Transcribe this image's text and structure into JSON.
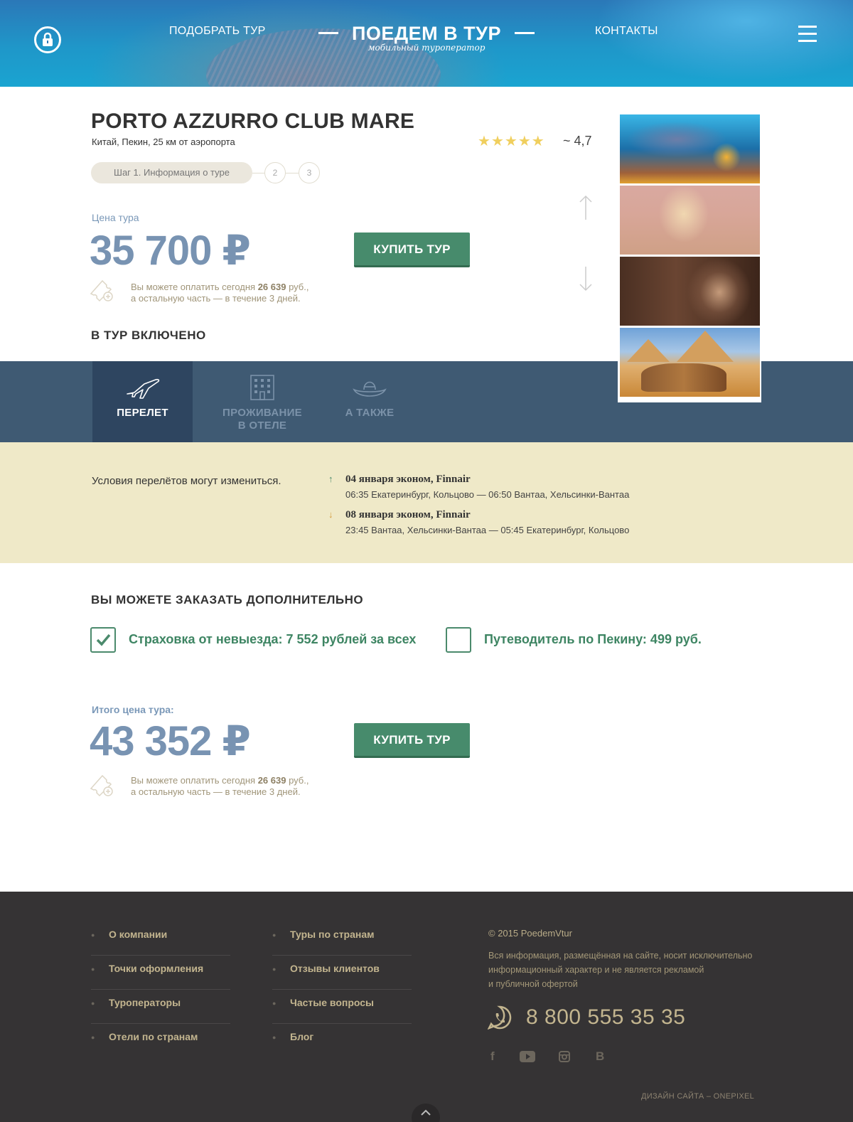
{
  "header": {
    "nav_pick": "ПОДОБРАТЬ ТУР",
    "nav_contacts": "КОНТАКТЫ",
    "logo_title": "ПОЕДЕМ В ТУР",
    "logo_subtitle": "мобильный туроператор",
    "icons": {
      "lock": "lock-icon",
      "menu": "menu-icon"
    }
  },
  "hotel": {
    "name": "PORTO AZZURRO CLUB MARE",
    "location": "Китай, Пекин, 25 км от аэропорта",
    "rating_stars": 5,
    "rating_value": "~ 4,7"
  },
  "steps": {
    "step1": "Шаг 1. Информация о туре",
    "step2": "2",
    "step3": "3"
  },
  "price": {
    "label": "Цена тура",
    "value": "35 700 ₽",
    "buy_label": "КУПИТЬ ТУР",
    "pay_line1_prefix": "Вы можете оплатить сегодня ",
    "pay_amount": "26 639",
    "pay_line1_suffix": " руб.,",
    "pay_line2": "а остальную часть — в течение 3 дней."
  },
  "included": {
    "title": "В ТУР ВКЛЮЧЕНО",
    "tabs": [
      {
        "label": "ПЕРЕЛЕТ",
        "icon": "plane-icon"
      },
      {
        "label_line1": "ПРОЖИВАНИЕ",
        "label_line2": "В ОТЕЛЕ",
        "icon": "hotel-icon"
      },
      {
        "label": "А ТАКЖЕ",
        "icon": "sombrero-icon"
      }
    ]
  },
  "flight": {
    "note": "Условия перелётов могут измениться.",
    "items": [
      {
        "direction": "↑",
        "title": "04 января эконом, Finnair",
        "route": "06:35 Екатеринбург, Кольцово — 06:50 Вантаа, Хельсинки-Вантаа"
      },
      {
        "direction": "↓",
        "title": "08 января эконом, Finnair",
        "route": "23:45 Вантаа, Хельсинки-Вантаа — 05:45 Екатеринбург, Кольцово"
      }
    ]
  },
  "extras": {
    "title": "ВЫ МОЖЕТЕ ЗАКАЗАТЬ ДОПОЛНИТЕЛЬНО",
    "items": [
      {
        "label": "Страховка от невыезда: 7 552 рублей за всех",
        "checked": true
      },
      {
        "label": "Путеводитель по Пекину: 499 руб.",
        "checked": false
      }
    ]
  },
  "total": {
    "label": "Итого цена тура:",
    "value": "43 352 ₽",
    "buy_label": "КУПИТЬ ТУР",
    "pay_line1_prefix": "Вы можете оплатить сегодня ",
    "pay_amount": "26 639",
    "pay_line1_suffix": " руб.,",
    "pay_line2": "а остальную часть — в течение 3 дней."
  },
  "footer": {
    "col1": [
      "О компании",
      "Точки оформления",
      "Туроператоры",
      "Отели  по странам"
    ],
    "col2": [
      "Туры по странам",
      "Отзывы клиентов",
      "Частые вопросы",
      "Блог"
    ],
    "copyright": "© 2015 PoedemVtur",
    "disclaimer_line1": "Вся информация, размещённая на сайте, носит исключительно",
    "disclaimer_line2": "информационный характер и не является рекламой",
    "disclaimer_line3": "и публичной офертой",
    "phone": "8 800 555 35 35",
    "social": [
      "f",
      "youtube-icon",
      "instagram-icon",
      "B"
    ],
    "credit": "ДИЗАЙН САЙТА – ONEPIXEL"
  },
  "colors": {
    "accent_green": "#478b6c",
    "price_blue": "#7893b2",
    "tabs_bar": "#3f5a73",
    "flight_bg": "#efe9c8",
    "footer_bg": "#353334"
  }
}
